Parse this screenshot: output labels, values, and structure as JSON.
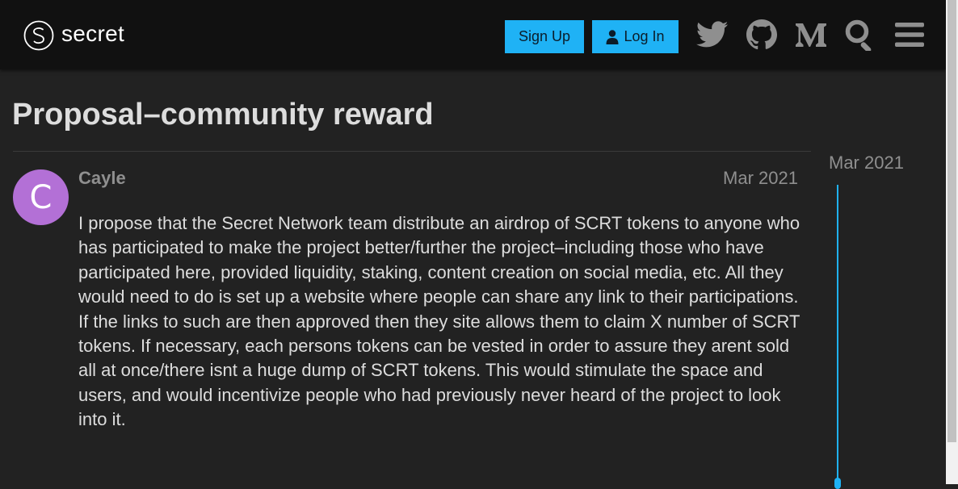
{
  "header": {
    "logo_text": "secret",
    "signup_label": "Sign Up",
    "login_label": "Log In",
    "icons": [
      "twitter-icon",
      "github-icon",
      "medium-icon",
      "search-icon",
      "menu-icon"
    ],
    "accent_color": "#1fb2f5"
  },
  "topic": {
    "title": "Proposal–community reward"
  },
  "post": {
    "avatar_letter": "C",
    "avatar_color": "#b370d6",
    "username": "Cayle",
    "date": "Mar 2021",
    "body": "I propose that the Secret Network team distribute an airdrop of SCRT tokens to anyone who has participated to make the project better/further the project–including those who have participated here, provided liquidity, staking, content creation on social media, etc. All they would need to do is set up a website where people can share any link to their participations. If the links to such are then approved then they site allows them to claim X number of SCRT tokens. If necessary, each persons tokens can be vested in order to assure they arent sold all at once/there isnt a huge dump of SCRT tokens. This would stimulate the space and users, and would incentivize people who had previously never heard of the project to look into it."
  },
  "timeline": {
    "start_date": "Mar 2021"
  }
}
